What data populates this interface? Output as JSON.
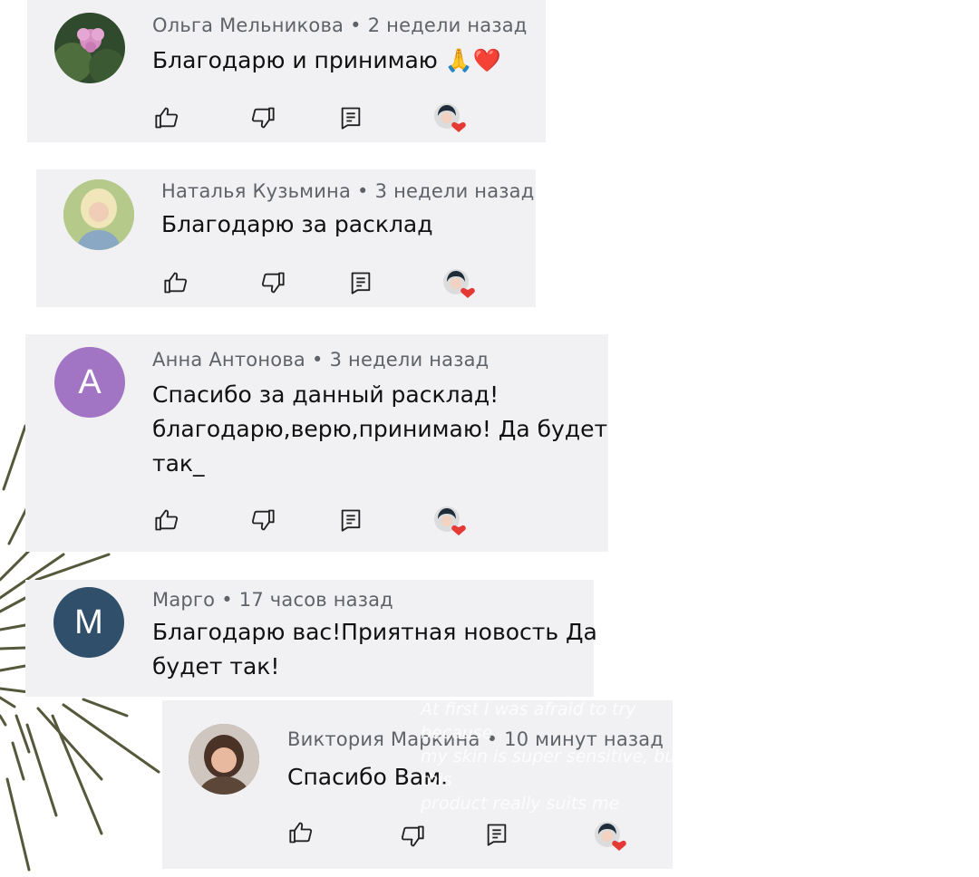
{
  "comments": [
    {
      "author": "Ольга Мельникова",
      "time": "2 недели назад",
      "lines": [
        "Благодарю и принимаю 🙏❤️"
      ],
      "avatar_icon": "flower-avatar-icon"
    },
    {
      "author": "Наталья Кузьмина",
      "time": "3 недели назад",
      "lines": [
        "Благодарю за расклад"
      ],
      "avatar_icon": "woman-photo-avatar-icon"
    },
    {
      "author": "Анна Антонова",
      "time": "3 недели назад",
      "lines": [
        "Спасибо за данный расклад!",
        "благодарю,верю,принимаю!  Да будет",
        "так_"
      ],
      "avatar_letter": "А",
      "avatar_color": "#a274c4"
    },
    {
      "author": "Марго",
      "time": "17 часов назад",
      "lines": [
        "Благодарю вас!Приятная новость Да",
        "будет так!"
      ],
      "avatar_letter": "М",
      "avatar_color": "#2f4f6b"
    },
    {
      "author": "Виктория Маркина",
      "time": "10 минут назад",
      "lines": [
        "Спасибо Вам."
      ],
      "avatar_icon": "woman-photo-avatar-icon"
    }
  ],
  "separator": "•",
  "overlay_text": [
    "At first I was afraid to try because",
    "my skin is super sensitive, but this",
    "product really suits me"
  ],
  "icons": {
    "like": "thumb-up-icon",
    "dislike": "thumb-down-icon",
    "reply": "reply-icon",
    "creator_heart": "creator-heart-icon"
  },
  "colors": {
    "card_bg": "#f1f1f3",
    "meta": "#5f6368",
    "heart": "#e53935",
    "burst": "#55583a"
  }
}
